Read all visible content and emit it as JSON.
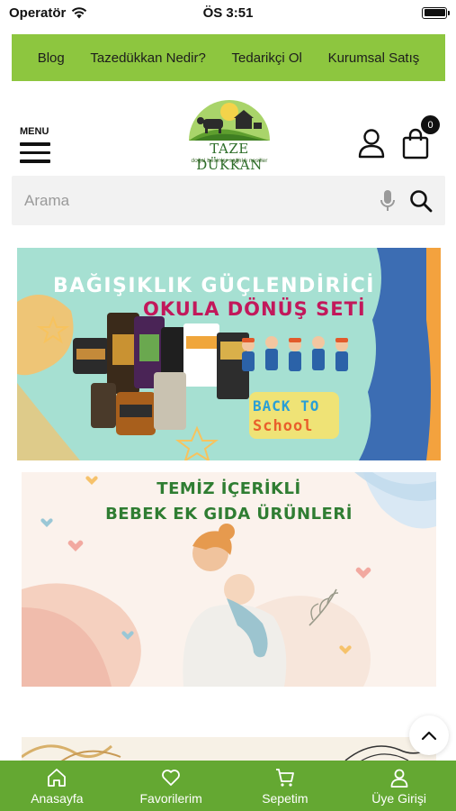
{
  "status_bar": {
    "carrier": "Operatör",
    "time": "ÖS 3:51"
  },
  "top_nav": {
    "links": [
      "Blog",
      "Tazedükkan Nedir?",
      "Tedarikçi Ol",
      "Kurumsal Satış"
    ]
  },
  "header": {
    "menu_label": "MENU",
    "logo_title": "TAZE DÜKKAN",
    "logo_subtitle": "doğal besinler sağlıklı nesiller",
    "cart_count": "0"
  },
  "search": {
    "placeholder": "Arama"
  },
  "banners": {
    "immunity": {
      "line1": "BAĞIŞIKLIK GÜÇLENDİRİCİ",
      "line2": "OKULA DÖNÜŞ SETİ",
      "back": "BACK TO",
      "school": "School"
    },
    "baby": {
      "line1": "TEMİZ İÇERİKLİ",
      "line2": "BEBEK EK GIDA ÜRÜNLERİ"
    }
  },
  "bottom_nav": {
    "items": [
      "Anasayfa",
      "Favorilerim",
      "Sepetim",
      "Üye Girişi"
    ]
  },
  "colors": {
    "top_nav_bg": "#8dc63f",
    "bottom_nav_bg": "#64a832",
    "banner1_bg": "#a6e0d2",
    "banner2_bg": "#fbf2ec"
  }
}
